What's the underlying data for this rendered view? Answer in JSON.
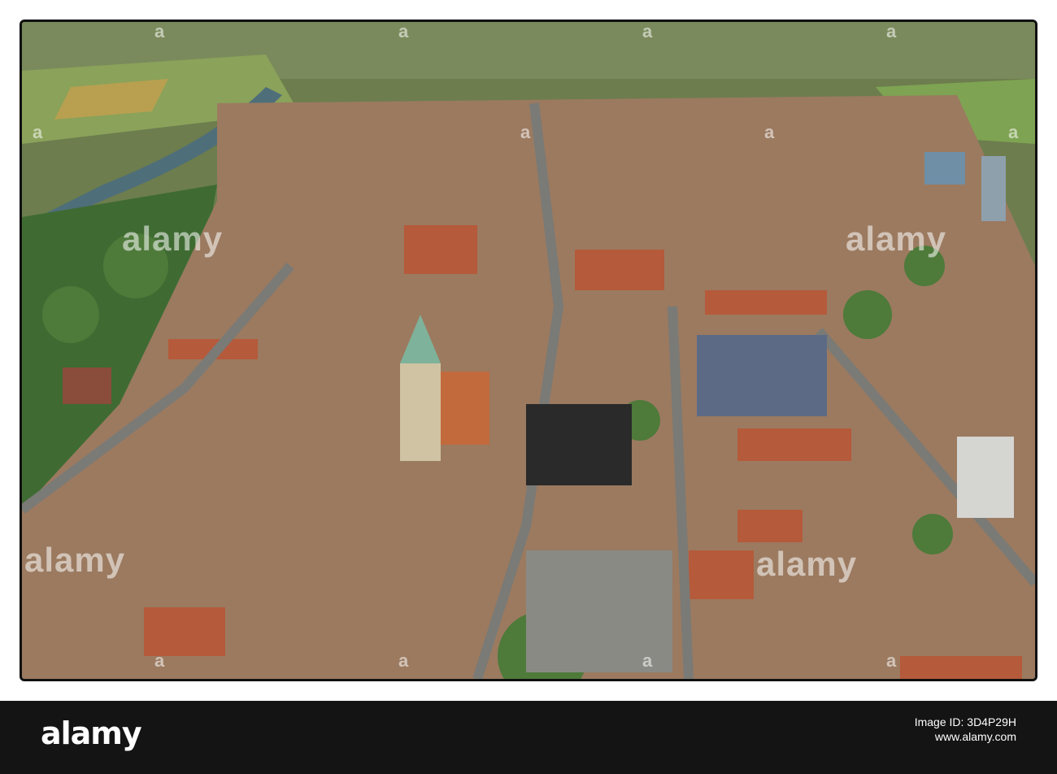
{
  "photo": {
    "subject": "aerial-city-view-church-square",
    "colors": {
      "greenery": "#4e7a3a",
      "roofs": "#b55a3a",
      "river": "#4e6e7a",
      "streets": "#7a7a76",
      "church_spire": "#7fb29a"
    }
  },
  "watermark": {
    "brand": "alamy",
    "code": "a",
    "wide_brand": "alamy"
  },
  "footer": {
    "logo": "alamy",
    "id_label": "Image ID: 3D4P29H",
    "url": "www.alamy.com"
  }
}
